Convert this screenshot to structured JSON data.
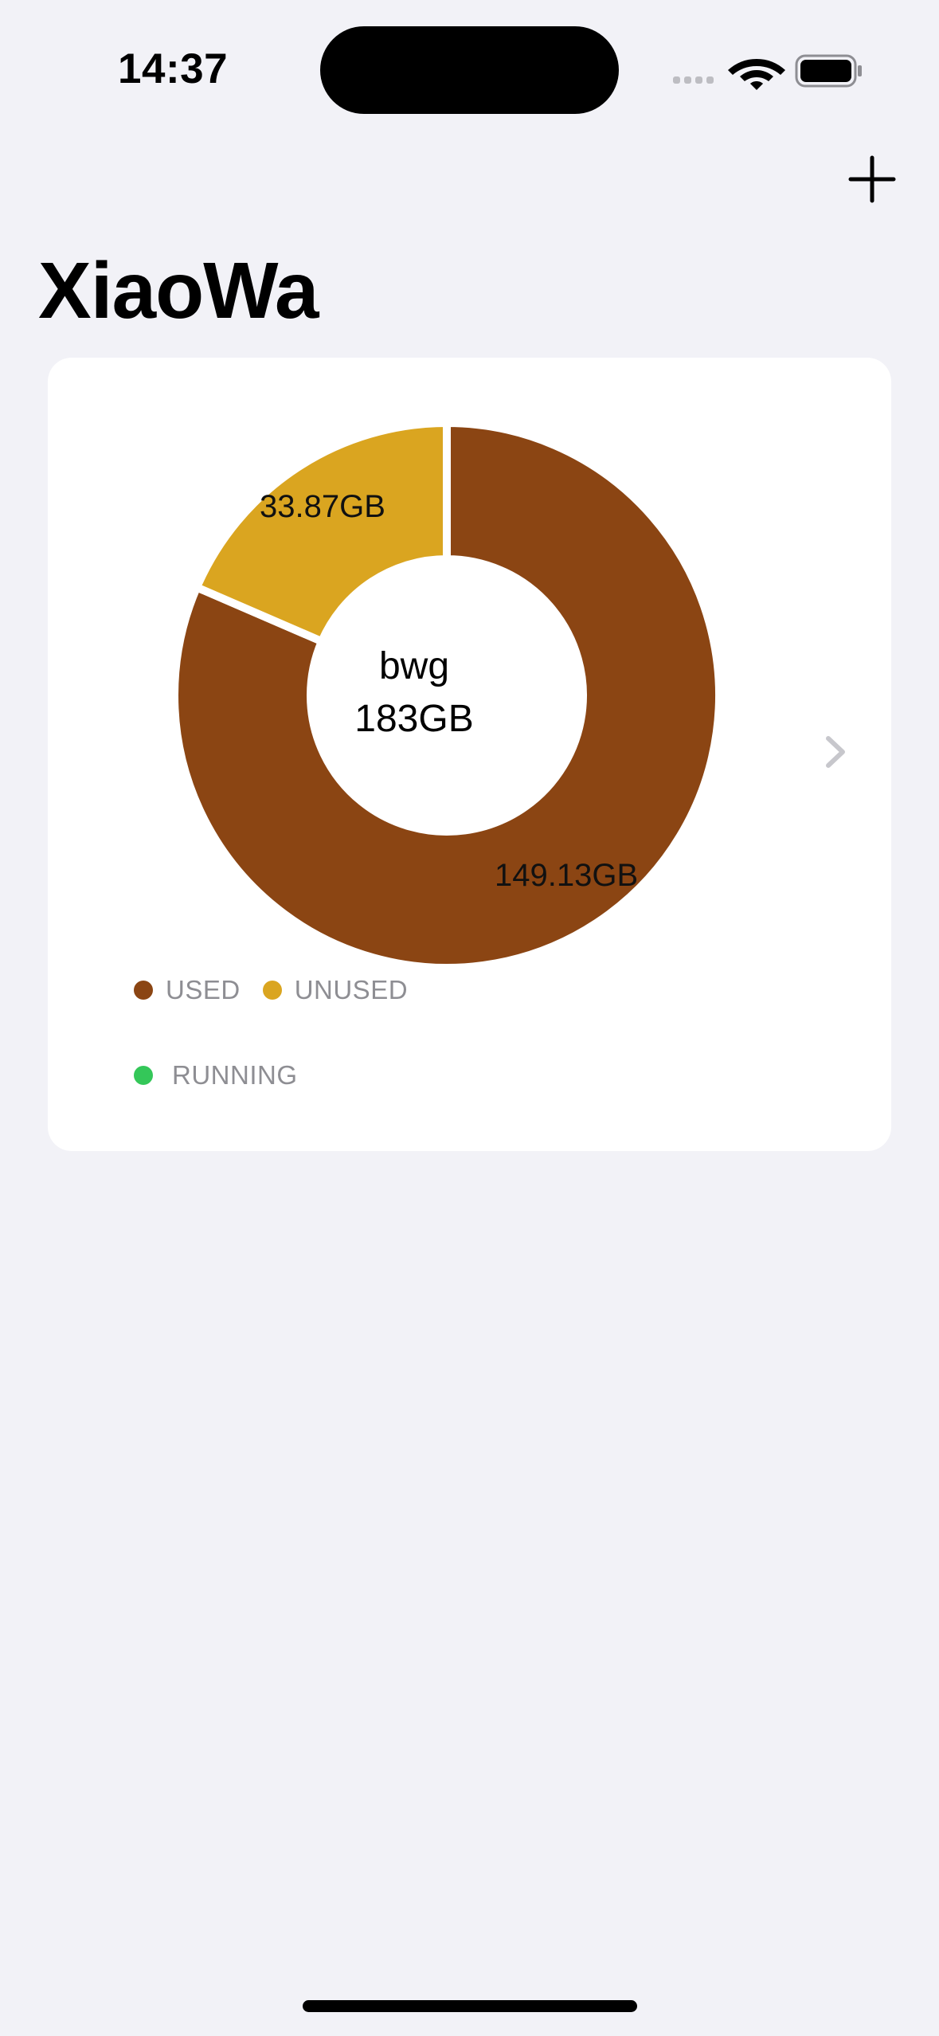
{
  "status_bar": {
    "time": "14:37"
  },
  "header": {
    "title": "XiaoWa",
    "add_icon": "plus-icon"
  },
  "server_card": {
    "name": "bwg",
    "total": "183GB",
    "used_label": "149.13GB",
    "unused_label": "33.87GB",
    "legend": {
      "used": "USED",
      "unused": "UNUSED",
      "running": "RUNNING"
    },
    "colors": {
      "used": "#8B4513",
      "unused": "#DAA520",
      "running": "#34C759"
    },
    "chevron_icon": "chevron-right-icon"
  },
  "chart_data": {
    "type": "pie",
    "categories": [
      "USED",
      "UNUSED"
    ],
    "values": [
      149.13,
      33.87
    ],
    "title": "",
    "center_text": [
      "bwg",
      "183GB"
    ],
    "slice_labels": [
      "149.13GB",
      "33.87GB"
    ],
    "colors": [
      "#8B4513",
      "#DAA520"
    ],
    "legend": [
      "USED",
      "UNUSED",
      "RUNNING"
    ],
    "legend_placement": "bottom-left"
  }
}
